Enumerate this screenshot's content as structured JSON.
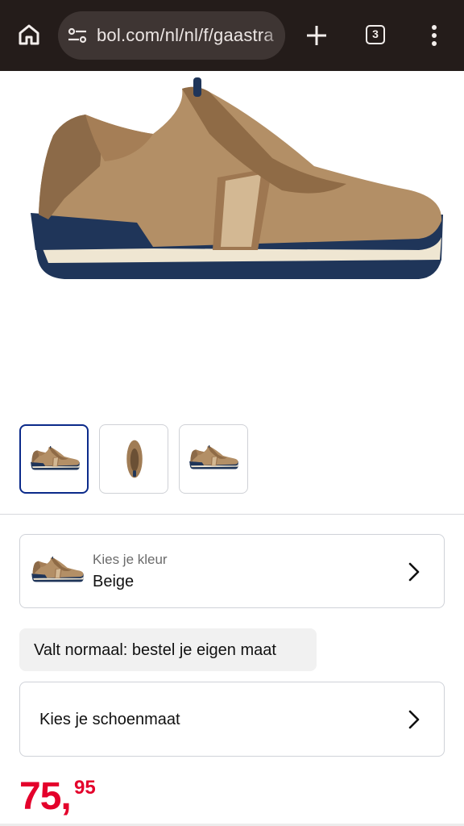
{
  "browser": {
    "url": "bol.com/nl/nl/f/gaastra",
    "tab_count": "3",
    "icons": [
      "home-icon",
      "site-settings-icon",
      "plus-icon",
      "tab-switcher-icon",
      "more-vert-icon"
    ]
  },
  "gallery": {
    "selected_index": 0,
    "thumbnails": [
      "side-view",
      "top-view",
      "side-view"
    ]
  },
  "color_selector": {
    "label": "Kies je kleur",
    "value": "Beige"
  },
  "fit_hint": "Valt normaal: bestel je eigen maat",
  "size_selector": {
    "label": "Kies je schoenmaat"
  },
  "price": {
    "main": "75,",
    "cents": "95"
  },
  "colors": {
    "toolbar": "#241c1a",
    "url_pill": "#3e3533",
    "price": "#e4002b",
    "selected_thumb_border": "#0b2a8a"
  }
}
